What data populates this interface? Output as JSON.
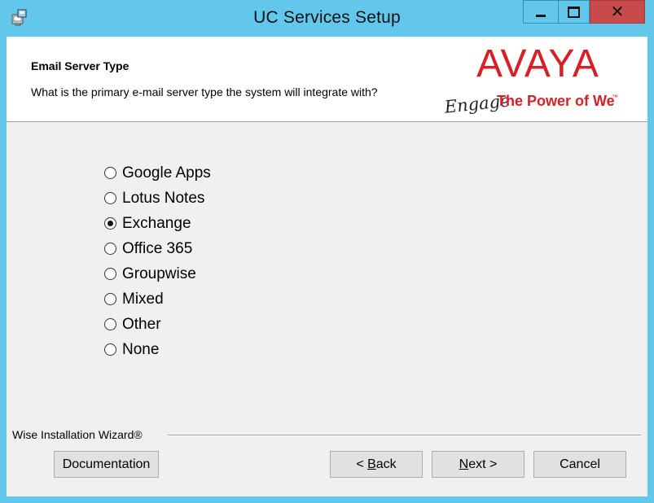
{
  "window": {
    "title": "UC Services Setup"
  },
  "title_buttons": {
    "minimize": "minimize-icon",
    "maximize": "maximize-icon",
    "close": "✕"
  },
  "header": {
    "title": "Email Server Type",
    "description": "What is the primary e-mail server type the system will integrate with?",
    "logo": {
      "brand": "AVAYA",
      "tagline_script": "Engage",
      "tagline": "The Power of We",
      "tm": "™",
      "color": "#d71f26"
    }
  },
  "email_server_options": [
    {
      "label": "Google Apps",
      "selected": false
    },
    {
      "label": "Lotus Notes",
      "selected": false
    },
    {
      "label": "Exchange",
      "selected": true
    },
    {
      "label": "Office 365",
      "selected": false
    },
    {
      "label": "Groupwise",
      "selected": false
    },
    {
      "label": "Mixed",
      "selected": false
    },
    {
      "label": "Other",
      "selected": false
    },
    {
      "label": "None",
      "selected": false
    }
  ],
  "footer": {
    "brand_label": "Wise Installation Wizard®"
  },
  "buttons": {
    "documentation": "Documentation",
    "back_prefix": "< ",
    "back_accel": "B",
    "back_rest": "ack",
    "next_accel": "N",
    "next_rest": "ext >",
    "cancel": "Cancel"
  }
}
